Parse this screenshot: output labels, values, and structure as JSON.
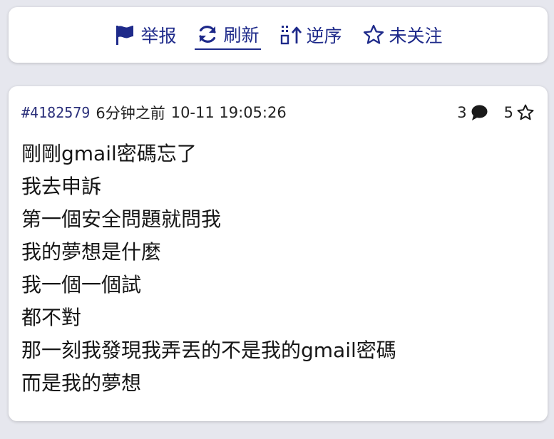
{
  "toolbar": {
    "report_label": "举报",
    "refresh_label": "刷新",
    "reverse_label": "逆序",
    "follow_label": "未关注"
  },
  "post": {
    "id": "#4182579",
    "relative_time": "6分钟之前",
    "timestamp": "10-11 19:05:26",
    "reply_count": "3",
    "like_count": "5",
    "lines": [
      "剛剛gmail密碼忘了",
      "我去申訴",
      "第一個安全問題就問我",
      "我的夢想是什麼",
      "我一個一個試",
      "都不對",
      "那一刻我發現我弄丟的不是我的gmail密碼",
      "而是我的夢想"
    ]
  },
  "colors": {
    "accent": "#1e2a8a",
    "background": "#e6e7ee",
    "card": "#ffffff"
  }
}
